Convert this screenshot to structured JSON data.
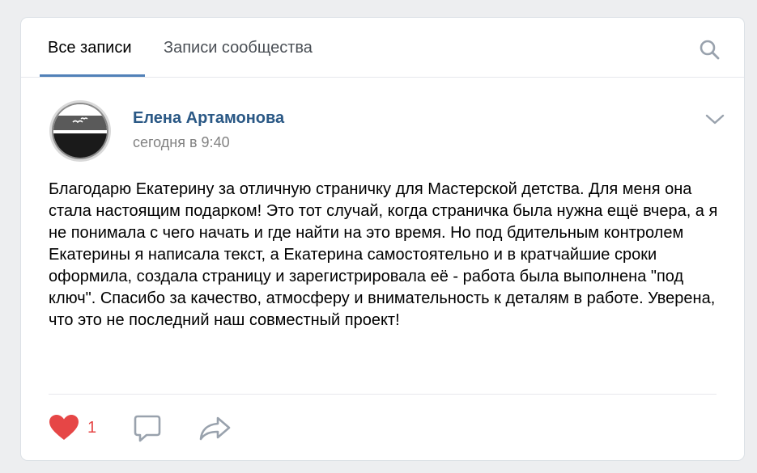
{
  "tabs": [
    {
      "label": "Все записи",
      "active": true
    },
    {
      "label": "Записи сообщества",
      "active": false
    }
  ],
  "icons": {
    "search": "search-icon",
    "menu": "chevron-down-icon",
    "like": "heart-icon",
    "comment": "comment-icon",
    "share": "share-icon"
  },
  "post": {
    "author": "Елена Артамонова",
    "time": "сегодня в 9:40",
    "text": "Благодарю Екатерину за отличную страничку для Мастерской детства. Для меня она стала настоящим подарком! Это тот случай, когда страничка была нужна ещё вчера, а я не понимала с чего начать и где найти на это время. Но под бдительным контролем Екатерины я написала текст, а Екатерина самостоятельно и в кратчайшие сроки оформила, создала страницу и зарегистрировала её - работа была выполнена \"под ключ\". Спасибо за качество, атмосферу и внимательность к деталям в работе. Уверена, что это не последний наш совместный проект!",
    "likes": "1"
  },
  "colors": {
    "accent": "#5181b8",
    "author": "#2a5885",
    "like": "#e64646",
    "icon": "#99a2ad"
  }
}
